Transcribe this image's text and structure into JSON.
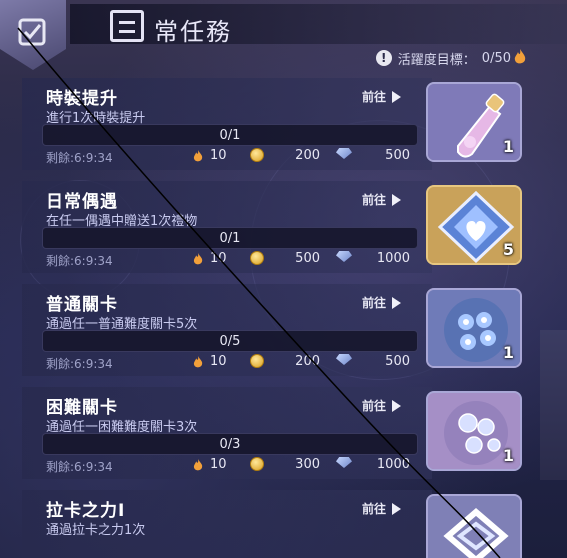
{
  "header": {
    "title": "常任務",
    "activity_label": "活躍度目標：",
    "activity_value": "0/50"
  },
  "tasks": [
    {
      "name": "時裝提升",
      "desc": "進行1次時裝提升",
      "goto": "前往",
      "progress": "0/1",
      "progress_ratio": 0,
      "remaining": "剩餘:6:9:34",
      "reward_activity": "10",
      "reward_gold": "200",
      "reward_gem": "500",
      "item_icon": "potion-icon",
      "item_count": "1"
    },
    {
      "name": "日常偶遇",
      "desc": "在任一偶遇中贈送1次禮物",
      "goto": "前往",
      "progress": "0/1",
      "progress_ratio": 0,
      "remaining": "剩餘:6:9:34",
      "reward_activity": "10",
      "reward_gold": "500",
      "reward_gem": "1000",
      "item_icon": "heart-crystal-icon",
      "item_count": "5"
    },
    {
      "name": "普通關卡",
      "desc": "通過任一普通難度關卡5次",
      "goto": "前往",
      "progress": "0/5",
      "progress_ratio": 0,
      "remaining": "剩餘:6:9:34",
      "reward_activity": "10",
      "reward_gold": "200",
      "reward_gem": "500",
      "item_icon": "blue-flowers-icon",
      "item_count": "1"
    },
    {
      "name": "困難關卡",
      "desc": "通過任一困難難度關卡3次",
      "goto": "前往",
      "progress": "0/3",
      "progress_ratio": 0,
      "remaining": "剩餘:6:9:34",
      "reward_activity": "10",
      "reward_gold": "300",
      "reward_gem": "1000",
      "item_icon": "silver-flowers-icon",
      "item_count": "1"
    },
    {
      "name": "拉卡之力I",
      "desc": "通過拉卡之力1次",
      "goto": "前往",
      "item_icon": "silver-emblem-icon"
    }
  ],
  "colors": {
    "panel": "#2c2e58",
    "accent": "#8fa0ff",
    "flame": "#f2a03a",
    "gold": "#e3b13a"
  }
}
